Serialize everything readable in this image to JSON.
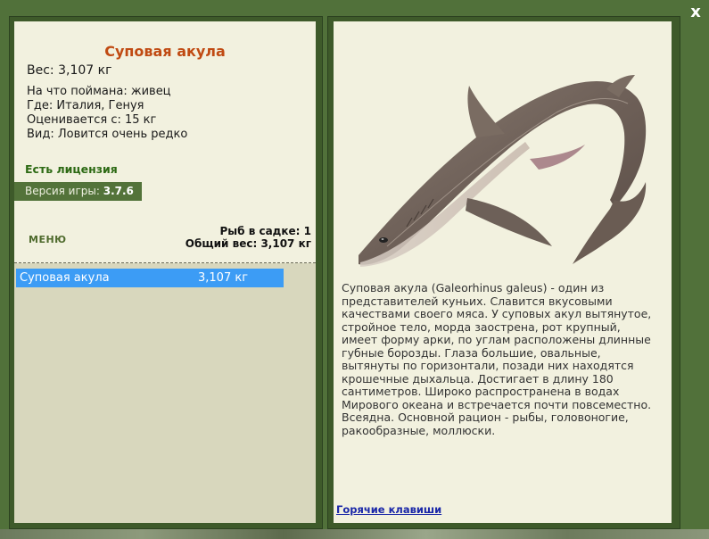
{
  "window": {
    "close_label": "x"
  },
  "fish": {
    "title": "Суповая акула",
    "weight_line": "Вес: 3,107 кг",
    "details": [
      "На что поймана: живец",
      "Где: Италия, Генуя",
      "Оценивается с: 15 кг",
      "Вид: Ловится очень редко"
    ],
    "license": "Есть лицензия",
    "description": "Суповая акула (Galeorhinus galeus) - один из представителей куньих. Славится вкусовыми качествами своего мяса. У суповых акул вытянутое, стройное тело, морда заострена, рот крупный, имеет форму арки, по углам расположены длинные губные борозды. Глаза большие, овальные, вытянуты по горизонтали, позади них находятся крошечные дыхальца. Достигает в длину 180 сантиметров. Широко распространена в водах Мирового океана и встречается почти повсеместно. Всеядна. Основной рацион - рыбы, головоногие, ракообразные, моллюски."
  },
  "version": {
    "label": "Версия игры:",
    "number": "3.7.6"
  },
  "menu": {
    "label": "МЕНЮ"
  },
  "stats": {
    "keepnet_line": "Рыб в садке: 1",
    "total_weight_line": "Общий вес: 3,107 кг"
  },
  "catch_list": [
    {
      "name": "Суповая акула",
      "weight": "3,107 кг"
    }
  ],
  "links": {
    "hotkeys": "Горячие клавиши"
  },
  "colors": {
    "background": "#51713a",
    "panel": "#f2f1df",
    "title": "#c04a12",
    "license": "#2d6a14",
    "selection": "#3c9cf5",
    "link": "#1a27a8"
  }
}
